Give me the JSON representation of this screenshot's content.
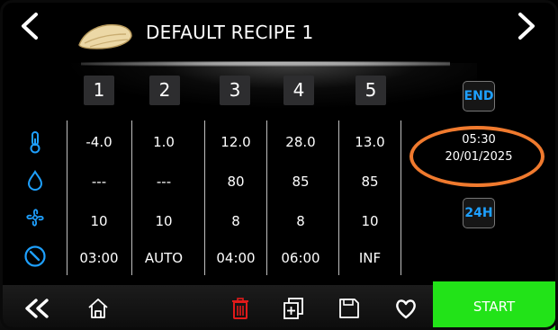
{
  "header": {
    "title": "DEFAULT RECIPE 1",
    "back_icon": "chevron-left-icon",
    "next_icon": "chevron-right-icon",
    "recipe_icon": "bread-dough-icon"
  },
  "steps": [
    "1",
    "2",
    "3",
    "4",
    "5"
  ],
  "row_icons": [
    "thermometer-icon",
    "humidity-drop-icon",
    "fan-icon",
    "timer-dial-icon"
  ],
  "table": {
    "temperature": [
      "-4.0",
      "1.0",
      "12.0",
      "28.0",
      "13.0"
    ],
    "humidity": [
      "---",
      "---",
      "80",
      "85",
      "85"
    ],
    "fan": [
      "10",
      "10",
      "8",
      "8",
      "10"
    ],
    "time": [
      "03:00",
      "AUTO",
      "04:00",
      "06:00",
      "INF"
    ]
  },
  "right_panel": {
    "end_label": "END",
    "time": "05:30",
    "date": "20/01/2025",
    "mode_label": "24H"
  },
  "footer": {
    "start_label": "START",
    "icons": [
      "double-chevron-left-icon",
      "home-icon",
      "delete-icon",
      "duplicate-icon",
      "save-icon",
      "favorite-icon"
    ]
  },
  "colors": {
    "accent_blue": "#1ea0ff",
    "start_green": "#22e318",
    "delete_red": "#e21a1a",
    "annotation_orange": "#f07a2e"
  }
}
